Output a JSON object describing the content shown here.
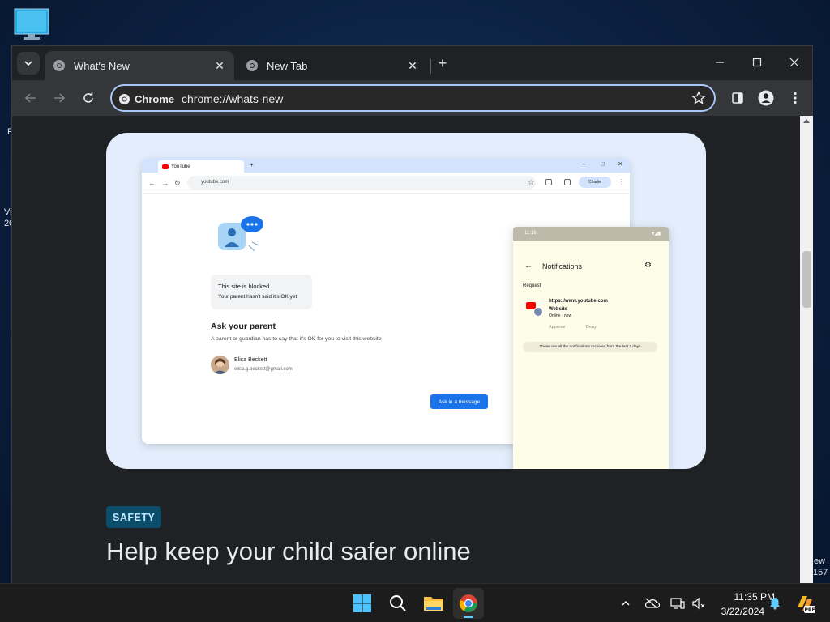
{
  "desktop": {
    "edge_texts": [
      "R",
      "Vi",
      "20",
      "ew",
      "157"
    ]
  },
  "browser": {
    "tabs": [
      {
        "title": "What's New",
        "active": true
      },
      {
        "title": "New Tab",
        "active": false
      }
    ],
    "omnibox": {
      "chip_label": "Chrome",
      "url": "chrome://whats-new"
    },
    "icons": {
      "tab_search": "chevron-down-icon",
      "new_tab": "plus-icon",
      "minimize": "minimize-icon",
      "maximize": "maximize-icon",
      "close": "close-icon",
      "back": "back-arrow-icon",
      "forward": "forward-arrow-icon",
      "reload": "reload-icon",
      "bookmark": "star-icon",
      "side_panel": "side-panel-icon",
      "profile": "profile-icon",
      "menu": "kebab-menu-icon"
    }
  },
  "page": {
    "illustration": {
      "mini_browser": {
        "tab_title": "YouTube",
        "url": "youtube.com",
        "profile_name": "Charlie",
        "blocked_title": "This site is blocked",
        "blocked_sub": "Your parent hasn't said it's OK yet",
        "ask_title": "Ask your parent",
        "ask_sub": "A parent or guardian has to say that it's OK for you to visit this website",
        "parent_name": "Elisa Beckett",
        "parent_email": "elisa.g.beckett@gmail.com",
        "ask_button": "Ask in a message"
      },
      "phone": {
        "time": "11:16",
        "title": "Notifications",
        "section": "Request",
        "url": "https://www.youtube.com",
        "site_label": "Website",
        "status": "Online · now",
        "approve": "Approve",
        "deny": "Deny",
        "footer": "These are all the notifications received from the last 7 days"
      }
    },
    "badge": "SAFETY",
    "headline": "Help keep your child safer online"
  },
  "taskbar": {
    "apps": [
      "start-icon",
      "search-icon",
      "file-explorer-icon",
      "chrome-icon"
    ],
    "tray": [
      "chevron-up-icon",
      "onedrive-icon",
      "display-icon",
      "speaker-muted-icon",
      "bell-icon",
      "copilot-icon"
    ],
    "copilot_badge": "PRE",
    "time": "11:35 PM",
    "date": "3/22/2024"
  },
  "colors": {
    "accent": "#a8c7fa",
    "hero_bg": "#e3edfb",
    "badge_bg": "#0b4e6b",
    "button_blue": "#1a73e8"
  }
}
